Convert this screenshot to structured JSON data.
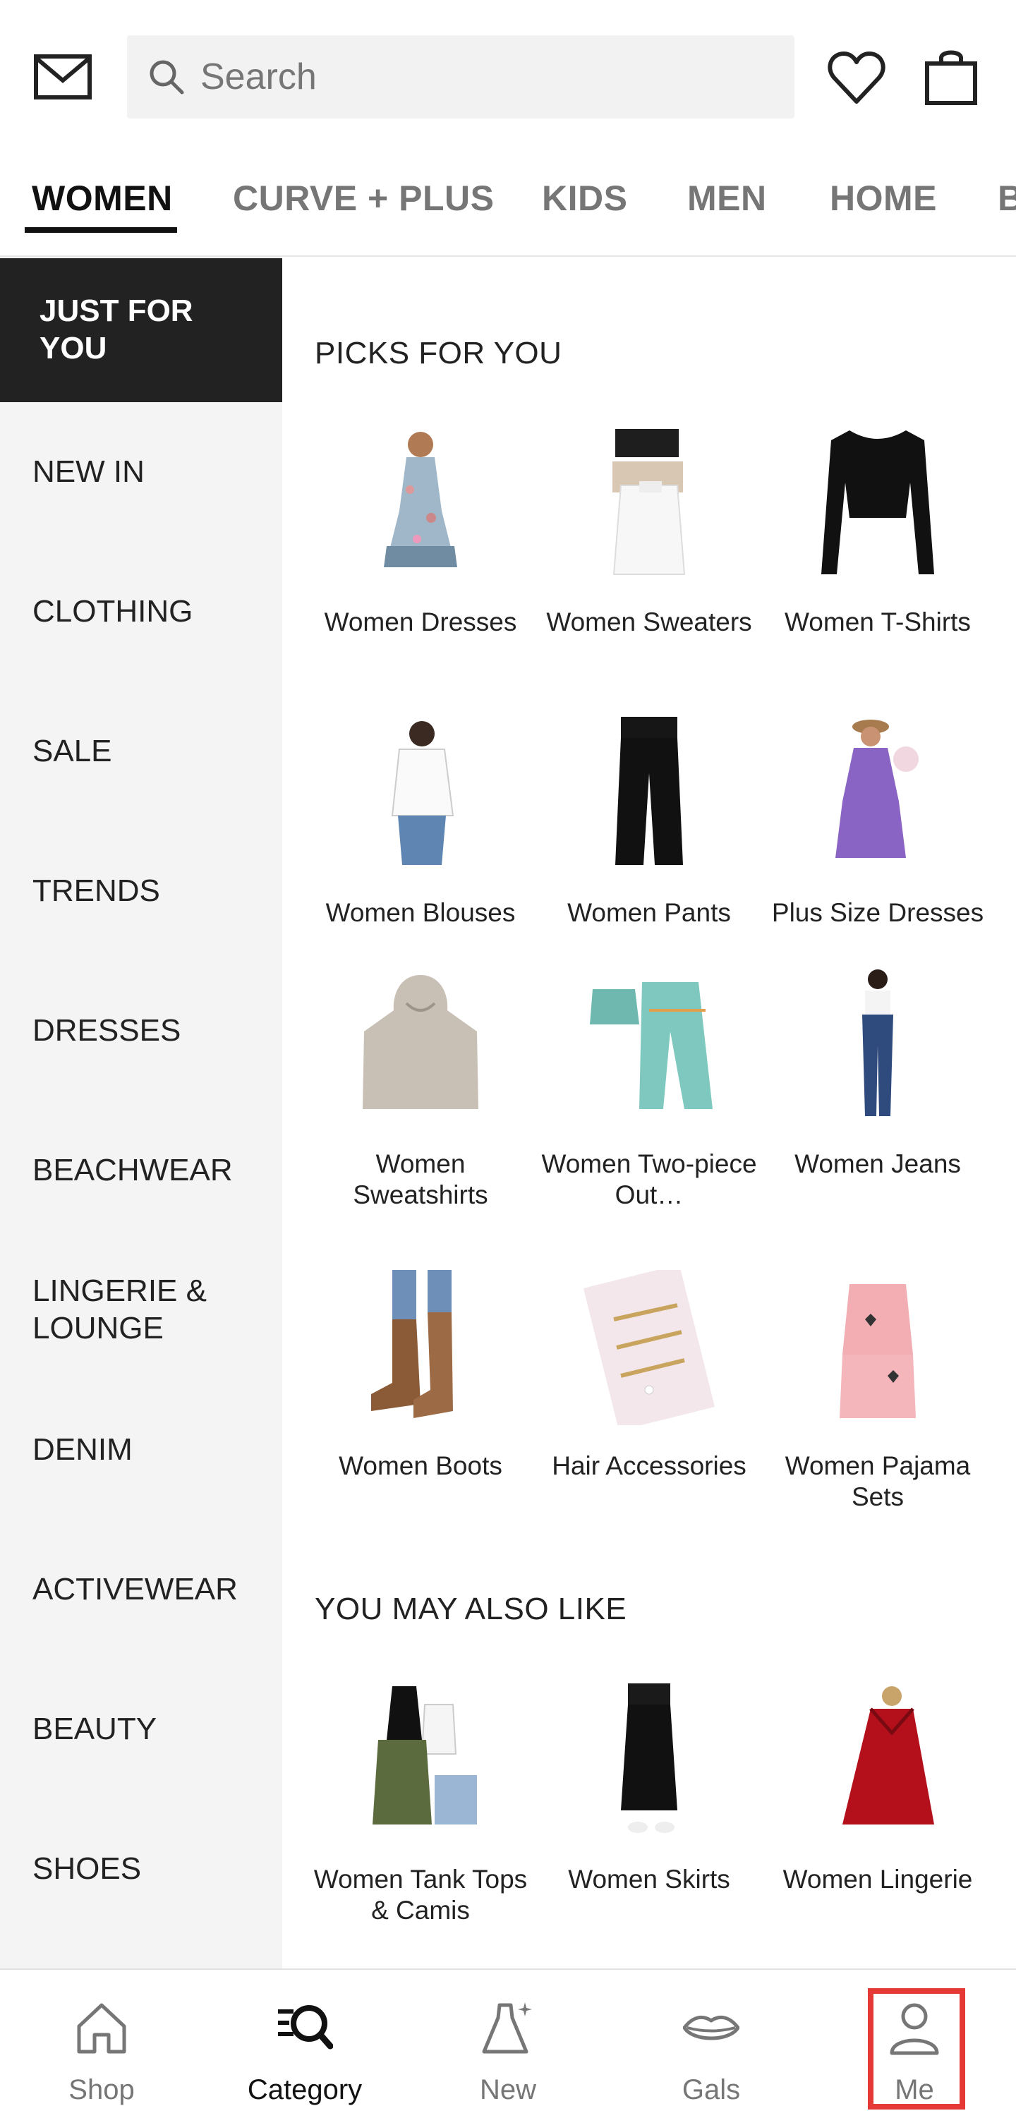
{
  "header": {
    "search_placeholder": "Search",
    "icons": [
      "mail-icon",
      "search-icon",
      "heart-icon",
      "bag-icon"
    ]
  },
  "tabs": [
    {
      "label": "WOMEN",
      "active": true
    },
    {
      "label": "CURVE + PLUS",
      "active": false
    },
    {
      "label": "KIDS",
      "active": false
    },
    {
      "label": "MEN",
      "active": false
    },
    {
      "label": "HOME",
      "active": false
    },
    {
      "label": "B",
      "active": false
    }
  ],
  "sidebar": {
    "items": [
      {
        "label": "JUST FOR YOU",
        "active": true
      },
      {
        "label": "NEW IN",
        "active": false
      },
      {
        "label": "CLOTHING",
        "active": false
      },
      {
        "label": "SALE",
        "active": false
      },
      {
        "label": "TRENDS",
        "active": false
      },
      {
        "label": "DRESSES",
        "active": false
      },
      {
        "label": "BEACHWEAR",
        "active": false
      },
      {
        "label": "LINGERIE & LOUNGE",
        "active": false
      },
      {
        "label": "DENIM",
        "active": false
      },
      {
        "label": "ACTIVEWEAR",
        "active": false
      },
      {
        "label": "BEAUTY",
        "active": false
      },
      {
        "label": "SHOES",
        "active": false
      }
    ]
  },
  "picks": {
    "title": "PICKS FOR YOU",
    "items": [
      {
        "label": "Women Dresses"
      },
      {
        "label": "Women Sweaters"
      },
      {
        "label": "Women T-Shirts"
      },
      {
        "label": "Women Blouses"
      },
      {
        "label": "Women Pants"
      },
      {
        "label": "Plus Size Dresses"
      },
      {
        "label": "Women Sweatshirts"
      },
      {
        "label": "Women Two-piece Out…"
      },
      {
        "label": "Women Jeans"
      },
      {
        "label": "Women Boots"
      },
      {
        "label": "Hair Accessories"
      },
      {
        "label": "Women Pajama Sets"
      }
    ]
  },
  "also_like": {
    "title": "YOU MAY ALSO LIKE",
    "items": [
      {
        "label": "Women Tank Tops & Camis"
      },
      {
        "label": "Women Skirts"
      },
      {
        "label": "Women Lingerie"
      }
    ]
  },
  "bottom_nav": {
    "items": [
      {
        "label": "Shop",
        "icon": "home-icon",
        "active": false
      },
      {
        "label": "Category",
        "icon": "category-search-icon",
        "active": true
      },
      {
        "label": "New",
        "icon": "dress-sparkle-icon",
        "active": false
      },
      {
        "label": "Gals",
        "icon": "lips-icon",
        "active": false
      },
      {
        "label": "Me",
        "icon": "person-icon",
        "active": false,
        "highlighted": true
      }
    ]
  },
  "colors": {
    "active_sidebar_bg": "#222222",
    "sidebar_bg": "#f4f4f4",
    "search_bg": "#f2f2f2",
    "inactive_tab": "#767676",
    "highlight_box": "#e53935"
  }
}
